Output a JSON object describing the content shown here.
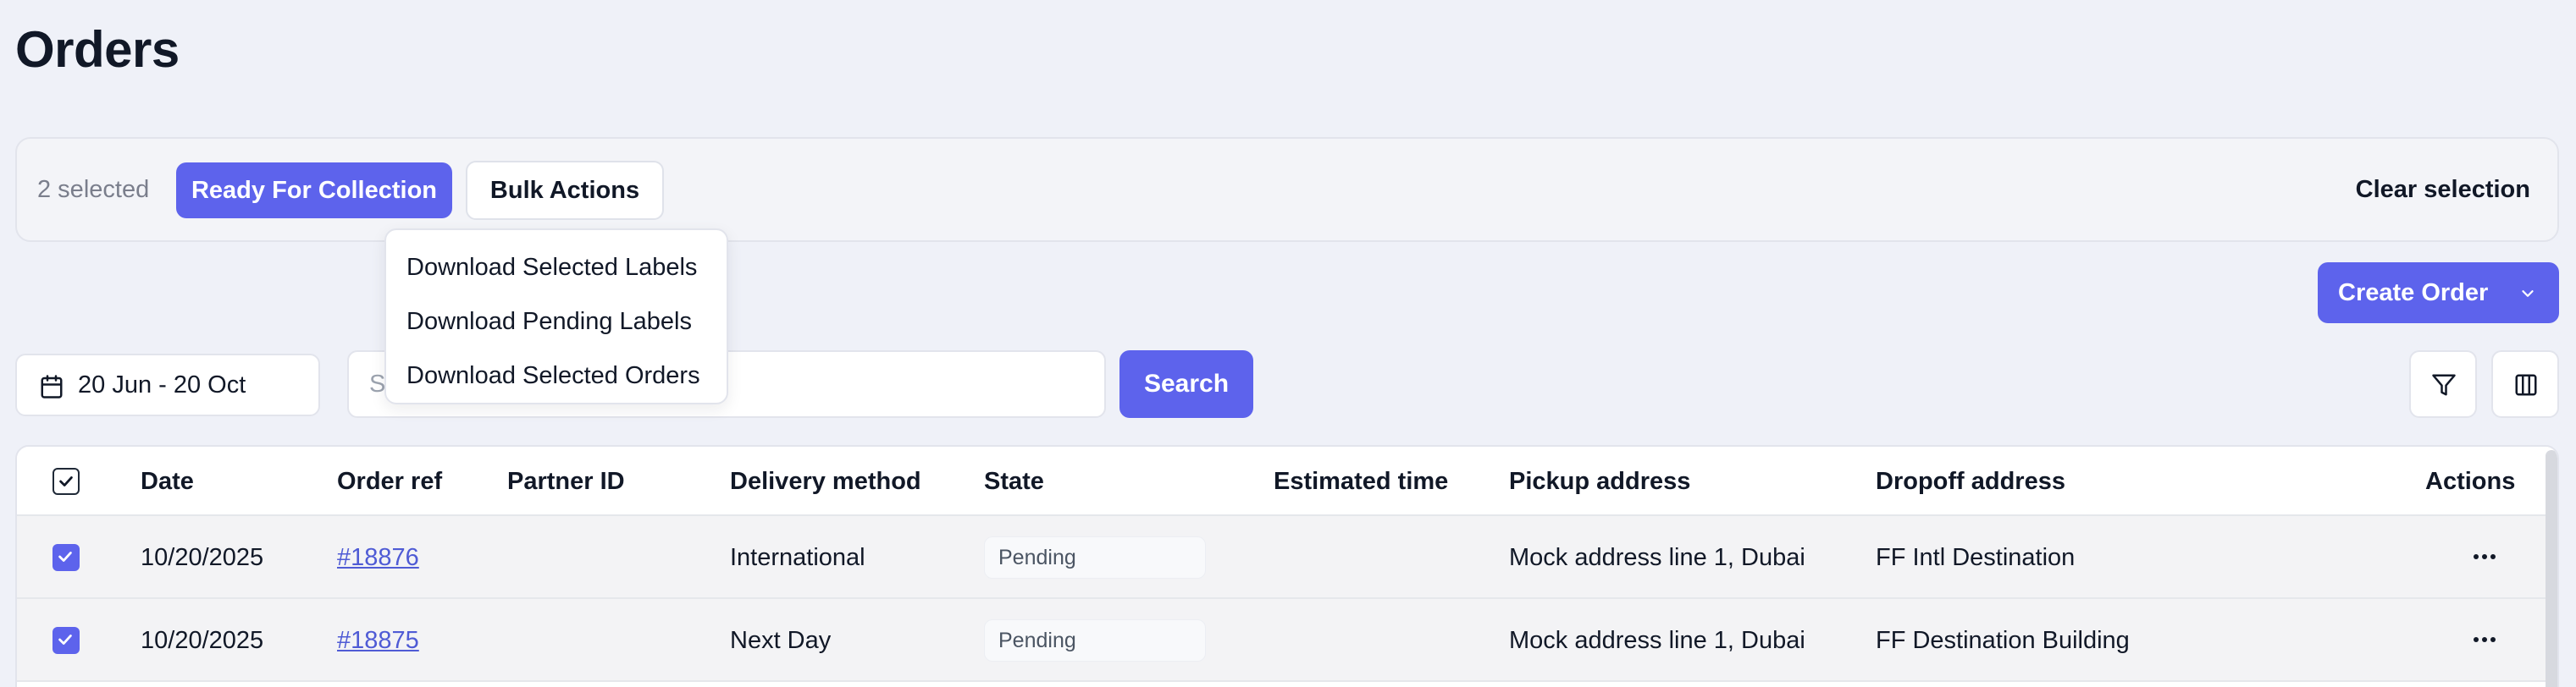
{
  "page": {
    "title": "Orders"
  },
  "selection_bar": {
    "count_text": "2 selected",
    "ready_label": "Ready For Collection",
    "bulk_label": "Bulk Actions",
    "clear_label": "Clear selection"
  },
  "bulk_menu": {
    "items": [
      "Download Selected Labels",
      "Download Pending Labels",
      "Download Selected Orders"
    ]
  },
  "create_order": {
    "label": "Create Order"
  },
  "filters": {
    "date_range": "20 Jun - 20 Oct",
    "search_placeholder": "Search by order id",
    "search_label": "Search"
  },
  "table": {
    "headers": [
      "Date",
      "Order ref",
      "Partner ID",
      "Delivery method",
      "State",
      "Estimated time",
      "Pickup address",
      "Dropoff address",
      "Actions"
    ],
    "rows": [
      {
        "date": "10/20/2025",
        "order_ref": "#18876",
        "partner_id": "",
        "delivery_method": "International",
        "state": "Pending",
        "estimated_time": "",
        "pickup": "Mock address line 1, Dubai",
        "dropoff": "FF Intl Destination"
      },
      {
        "date": "10/20/2025",
        "order_ref": "#18875",
        "partner_id": "",
        "delivery_method": "Next Day",
        "state": "Pending",
        "estimated_time": "",
        "pickup": "Mock address line 1, Dubai",
        "dropoff": "FF Destination Building"
      }
    ]
  },
  "colors": {
    "accent": "#5d63ec",
    "background": "#eff1f8",
    "link": "#4f5bd5"
  },
  "icons": [
    "calendar-icon",
    "chevron-down-icon",
    "filter-icon",
    "columns-icon",
    "check-icon",
    "more-horizontal-icon"
  ]
}
